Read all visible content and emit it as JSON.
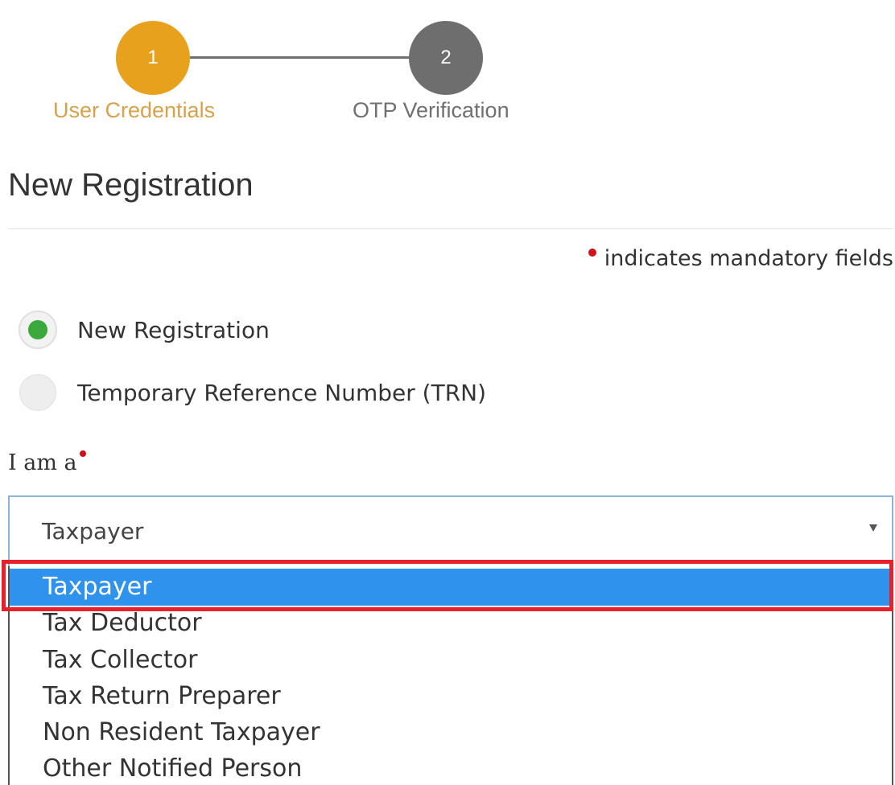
{
  "stepper": {
    "steps": [
      {
        "number": "1",
        "label": "User Credentials",
        "state": "active",
        "color": "#e8a11c"
      },
      {
        "number": "2",
        "label": "OTP Verification",
        "state": "inactive",
        "color": "#6e6e6e"
      }
    ]
  },
  "page": {
    "title": "New Registration"
  },
  "mandatory_note": {
    "text": "indicates mandatory fields",
    "dot_color": "#d1111a"
  },
  "registration_type": {
    "options": [
      {
        "label": "New Registration",
        "selected": true
      },
      {
        "label": "Temporary Reference Number (TRN)",
        "selected": false
      }
    ]
  },
  "user_type": {
    "label": "I am a",
    "selected_value": "Taxpayer",
    "options": [
      "Taxpayer",
      "Tax Deductor",
      "Tax Collector",
      "Tax Return Preparer",
      "Non Resident Taxpayer",
      "Other Notified Person"
    ],
    "highlighted_index": 0,
    "highlight_color": "#2f93ee",
    "annotation_color": "#e8202a"
  }
}
